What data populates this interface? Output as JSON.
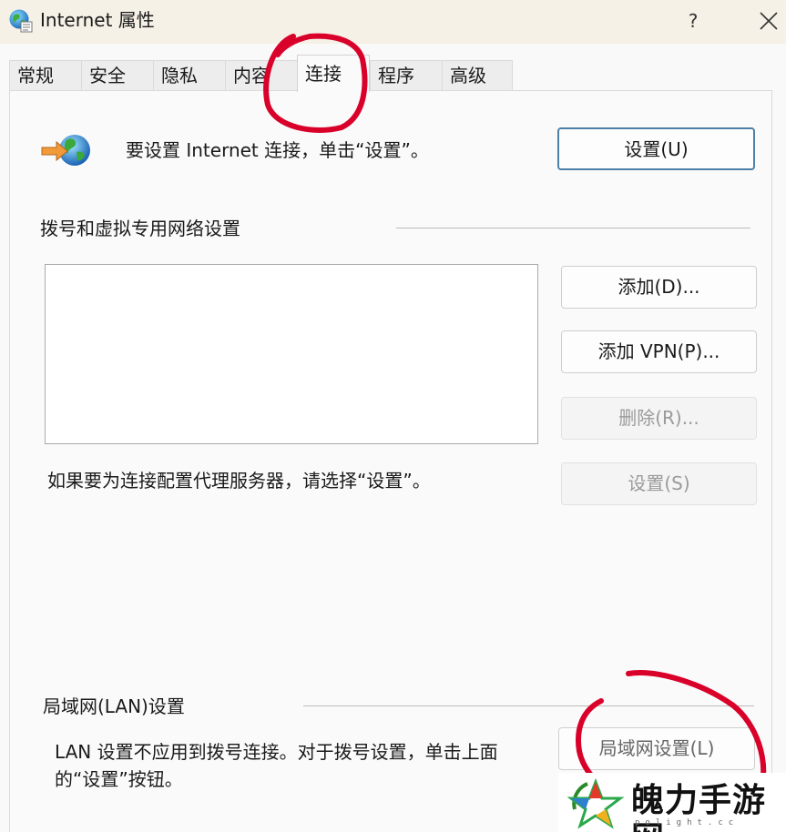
{
  "window": {
    "title": "Internet 属性",
    "help_label": "?"
  },
  "tabs": [
    {
      "label": "常规",
      "active": false
    },
    {
      "label": "安全",
      "active": false
    },
    {
      "label": "隐私",
      "active": false
    },
    {
      "label": "内容",
      "active": false
    },
    {
      "label": "连接",
      "active": true
    },
    {
      "label": "程序",
      "active": false
    },
    {
      "label": "高级",
      "active": false
    }
  ],
  "setup": {
    "text": "要设置 Internet 连接，单击“设置”。",
    "button": "设置(U)",
    "icon": "network-setup-icon"
  },
  "dialup": {
    "heading": "拨号和虚拟专用网络设置",
    "add_button": "添加(D)...",
    "add_vpn_button": "添加 VPN(P)...",
    "remove_button": "删除(R)...",
    "settings_button": "设置(S)",
    "proxy_text": "如果要为连接配置代理服务器，请选择“设置”。"
  },
  "lan": {
    "heading": "局域网(LAN)设置",
    "description": "LAN 设置不应用到拨号连接。对于拨号设置，单击上面的“设置”按钮。",
    "button": "局域网设置(L)"
  },
  "watermark": {
    "text": "魄力手游网",
    "sub": "polight.cc"
  },
  "colors": {
    "annotation": "#d9002a",
    "primary_border": "#4d7fa8",
    "disabled_text": "#9a9a9a"
  }
}
